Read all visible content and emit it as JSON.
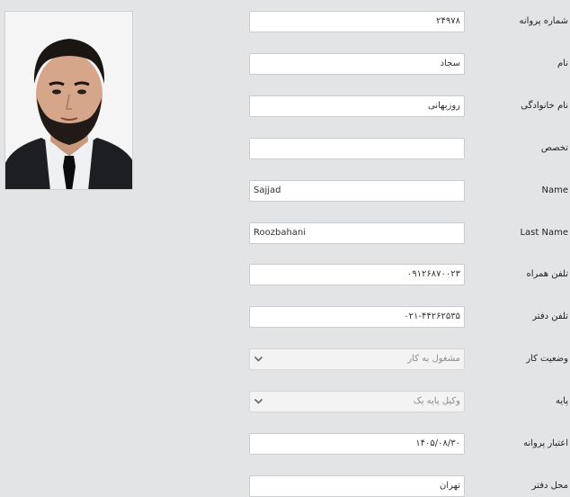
{
  "photo": {
    "icon": "user-portrait"
  },
  "fields": [
    {
      "label": "شماره پروانه",
      "value": "۲۴۹۷۸",
      "type": "text",
      "dir": "rtl"
    },
    {
      "label": "نام",
      "value": "سجاد",
      "type": "text",
      "dir": "rtl"
    },
    {
      "label": "نام خانوادگی",
      "value": "روزبهانی",
      "type": "text",
      "dir": "rtl"
    },
    {
      "label": "تخصص",
      "value": "",
      "type": "text",
      "dir": "rtl"
    },
    {
      "label": "Name",
      "value": "Sajjad",
      "type": "text",
      "dir": "ltr"
    },
    {
      "label": "Last Name",
      "value": "Roozbahani",
      "type": "text",
      "dir": "ltr"
    },
    {
      "label": "تلفن همراه",
      "value": "۰۹۱۲۶۸۷۰۰۲۳",
      "type": "text",
      "dir": "rtl"
    },
    {
      "label": "تلفن دفتر",
      "value": "۰۲۱-۴۴۲۶۲۵۳۵",
      "type": "text",
      "dir": "rtl"
    },
    {
      "label": "وضعیت کار",
      "value": "مشغول به کار",
      "type": "select",
      "dir": "rtl"
    },
    {
      "label": "پایه",
      "value": "وکیل پایه یک",
      "type": "select",
      "dir": "rtl"
    },
    {
      "label": "اعتبار پروانه",
      "value": "۱۴۰۵/۰۸/۳۰",
      "type": "text",
      "dir": "rtl"
    },
    {
      "label": "محل دفتر",
      "value": "تهران",
      "type": "text",
      "dir": "rtl"
    }
  ]
}
